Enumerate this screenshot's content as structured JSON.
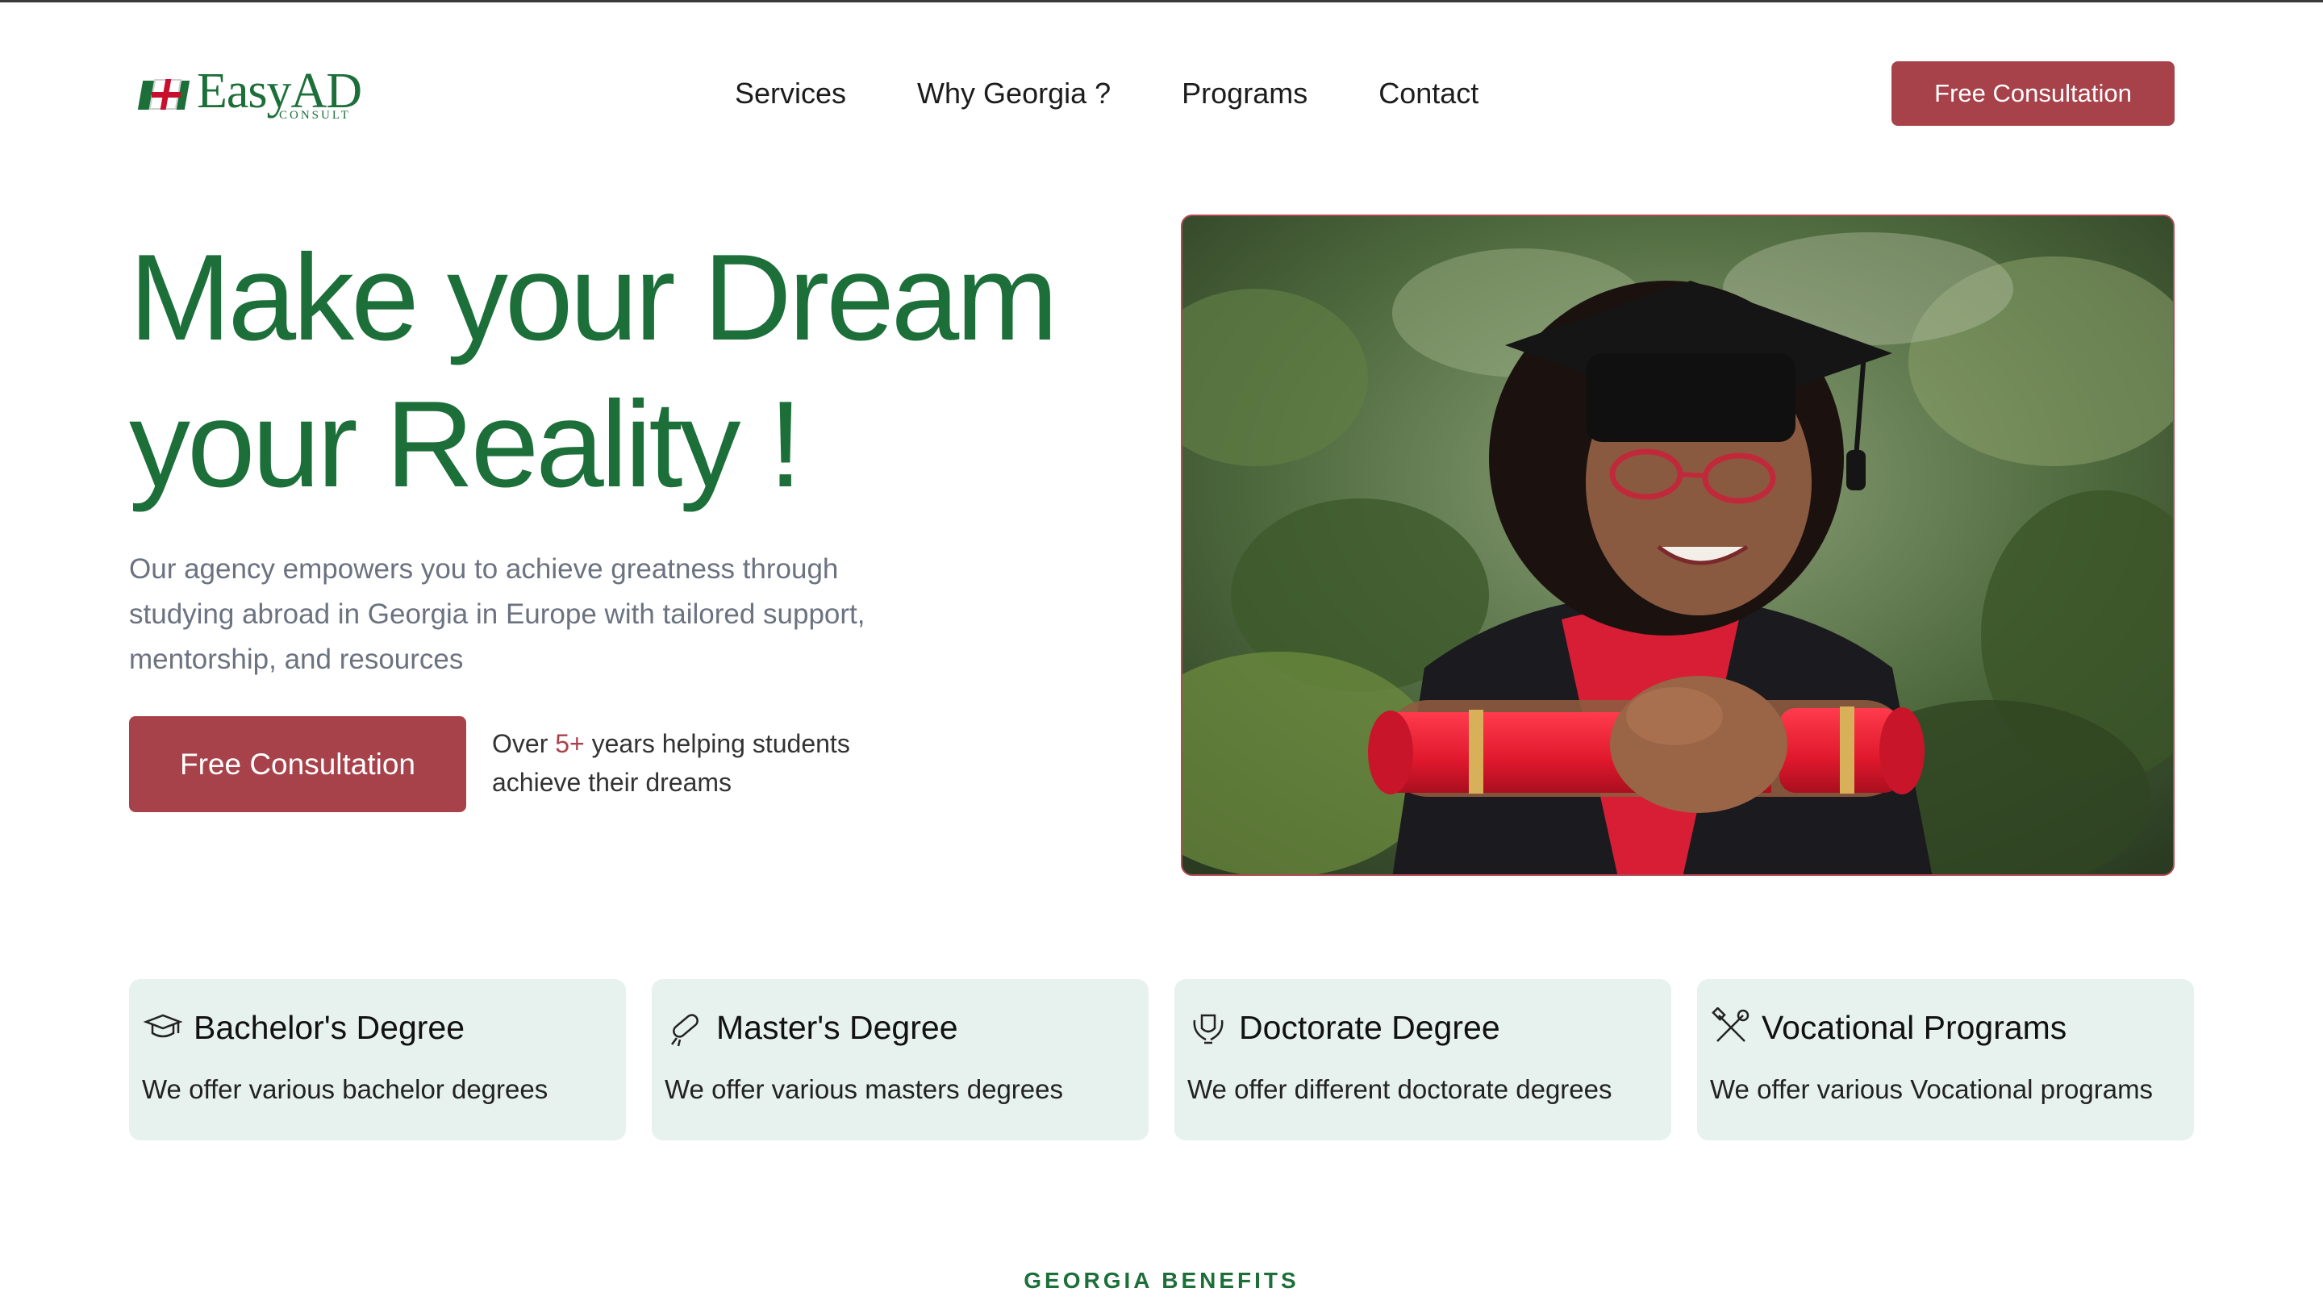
{
  "brand": {
    "name": "EasyAD",
    "tagline": "CONSULT"
  },
  "nav": {
    "items": [
      {
        "label": "Services"
      },
      {
        "label": "Why Georgia ?"
      },
      {
        "label": "Programs"
      },
      {
        "label": "Contact"
      }
    ],
    "cta": "Free Consultation"
  },
  "hero": {
    "title_line1": "Make your Dream",
    "title_line2": "your Reality !",
    "description": "Our agency empowers you to achieve greatness through studying abroad in Georgia in Europe with tailored support, mentorship, and resources",
    "cta": "Free Consultation",
    "stat_prefix": "Over ",
    "stat_value": "5+",
    "stat_suffix": " years helping students achieve their dreams",
    "image_icon": "graduate-photo"
  },
  "programs": [
    {
      "title": "Bachelor's Degree",
      "text": "We offer various bachelor degrees",
      "icon": "graduation-cap-icon"
    },
    {
      "title": "Master's Degree",
      "text": "We offer various masters degrees",
      "icon": "diploma-scroll-icon"
    },
    {
      "title": "Doctorate Degree",
      "text": "We offer different doctorate degrees",
      "icon": "laurel-shield-icon"
    },
    {
      "title": "Vocational Programs",
      "text": "We offer various Vocational programs",
      "icon": "tools-icon"
    }
  ],
  "section": {
    "label": "GEORGIA BENEFITS"
  },
  "colors": {
    "brand_green": "#1d6f3a",
    "accent_red": "#a8424a",
    "card_bg": "#e7f2ef"
  }
}
